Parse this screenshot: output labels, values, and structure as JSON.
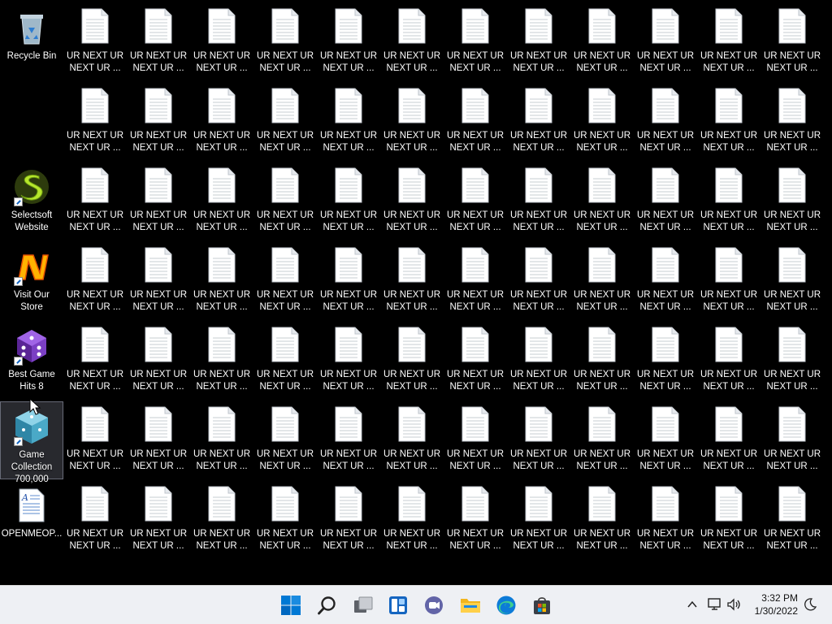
{
  "desktop": {
    "left_icons": [
      {
        "name": "recycle-bin",
        "label": "Recycle Bin",
        "kind": "recycle-bin-icon",
        "shortcut": false
      },
      {
        "name": "selectsoft-website",
        "label": "Selectsoft\nWebsite",
        "kind": "selectsoft-icon",
        "shortcut": true
      },
      {
        "name": "visit-our-store",
        "label": "Visit Our\nStore",
        "kind": "store-icon",
        "shortcut": true
      },
      {
        "name": "best-game-hits-8",
        "label": "Best Game\nHits 8",
        "kind": "dice-icon",
        "shortcut": true
      },
      {
        "name": "game-collection-700000",
        "label": "Game\nCollection\n700,000",
        "kind": "dice-cube-icon",
        "shortcut": true
      },
      {
        "name": "openmeop",
        "label": "OPENMEOP...",
        "kind": "wordpad-doc-icon",
        "shortcut": false
      }
    ],
    "file_label": "UR NEXT UR\nNEXT UR ...",
    "file_icon": "text-document-icon",
    "grid_rows": 7,
    "grid_cols": 12
  },
  "taskbar": {
    "buttons": [
      {
        "name": "start-button",
        "icon": "windows-logo-icon"
      },
      {
        "name": "search-button",
        "icon": "search-icon"
      },
      {
        "name": "task-view-button",
        "icon": "task-view-icon"
      },
      {
        "name": "widgets-button",
        "icon": "widgets-icon"
      },
      {
        "name": "chat-button",
        "icon": "teams-chat-icon"
      },
      {
        "name": "file-explorer-button",
        "icon": "folder-icon"
      },
      {
        "name": "edge-button",
        "icon": "edge-icon"
      },
      {
        "name": "store-button",
        "icon": "store-bag-icon"
      }
    ],
    "tray": {
      "time": "3:32 PM",
      "date": "1/30/2022"
    }
  },
  "colors": {
    "desktop_bg": "#000000",
    "taskbar_bg": "#eef0f4",
    "accent": "#0078d4"
  }
}
